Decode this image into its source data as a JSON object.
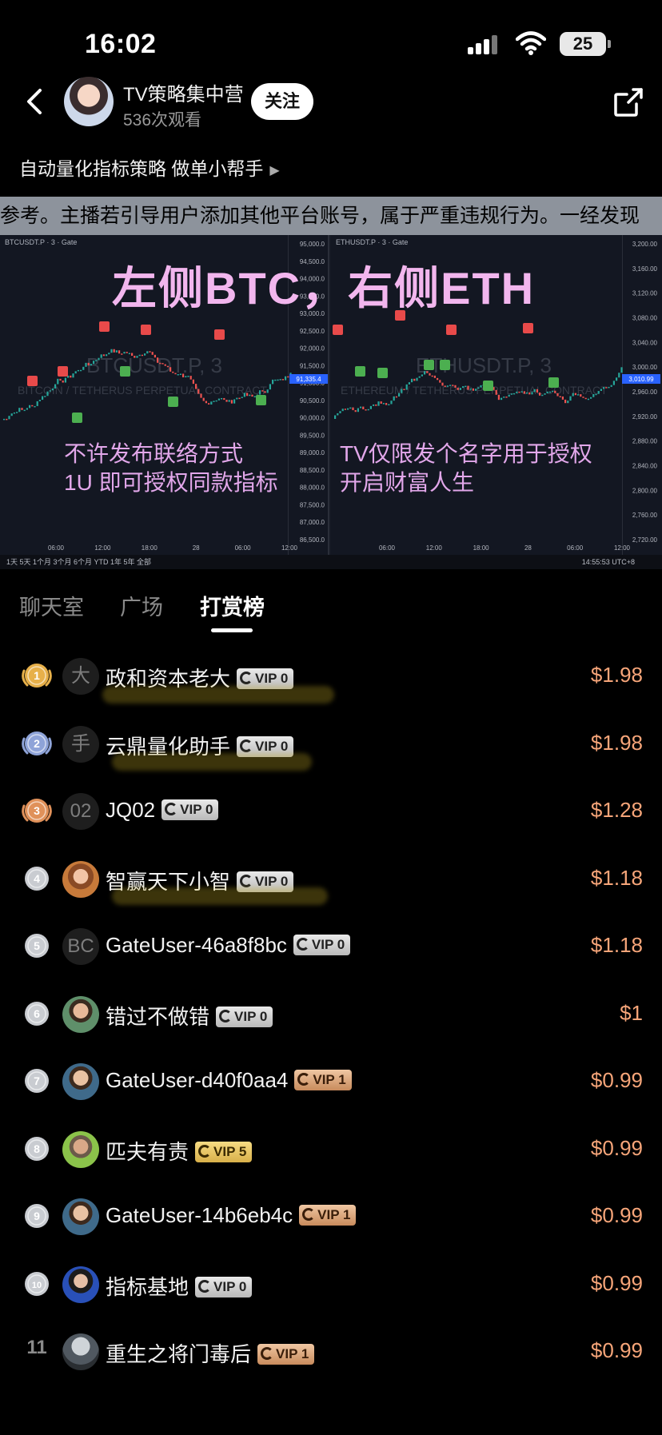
{
  "status_bar": {
    "time": "16:02",
    "battery": "25"
  },
  "header": {
    "host_name": "TV策略集中营",
    "views": "536次观看",
    "follow_label": "关注",
    "subtitle": "自动量化指标策略 做单小帮手",
    "subtitle_arrow": "▶"
  },
  "video": {
    "marquee": "参考。主播若引导用户添加其他平台账号，属于严重违规行为。一经发现",
    "title": "左侧BTC，右侧ETH",
    "left_line1": "不许发布联络方式",
    "left_line2": "1U 即可授权同款指标",
    "right_line1": "TV仅限发个名字用于授权",
    "right_line2": "开启财富人生",
    "btc_ticker": "BTCUSDT.P · 3 · Gate",
    "eth_ticker": "ETHUSDT.P · 3 · Gate",
    "btc_watermark": "BTCUSDT.P, 3",
    "btc_watermark2": "BITCOIN / TETHERUS PERPETUAL CONTRACT",
    "eth_watermark": "ETHUSDT.P, 3",
    "eth_watermark2": "ETHEREUM / TETHERUS PERPETUAL CONTRACT",
    "btc_price_label": "91,335.4",
    "eth_price_label": "3,010.99",
    "btc_axis": [
      "95,000.0",
      "94,500.0",
      "94,000.0",
      "93,500.0",
      "93,000.0",
      "92,500.0",
      "92,000.0",
      "91,500.0",
      "91,000.0",
      "90,500.0",
      "90,000.0",
      "89,500.0",
      "89,000.0",
      "88,500.0",
      "88,000.0",
      "87,500.0",
      "87,000.0",
      "86,500.0"
    ],
    "eth_axis": [
      "3,200.00",
      "3,160.00",
      "3,120.00",
      "3,080.00",
      "3,040.00",
      "3,000.00",
      "2,960.00",
      "2,920.00",
      "2,880.00",
      "2,840.00",
      "2,800.00",
      "2,760.00",
      "2,720.00"
    ],
    "time_axis_left": [
      "06:00",
      "12:00",
      "18:00",
      "28",
      "06:00",
      "12:00"
    ],
    "time_axis_right": [
      "06:00",
      "12:00",
      "18:00",
      "28",
      "06:00",
      "12:00"
    ],
    "bottom_toolbar": "1天  5天  1个月  3个月  6个月  YTD  1年  5年  全部",
    "bottom_time": "14:55:53 UTC+8"
  },
  "tabs": [
    {
      "label": "聊天室"
    },
    {
      "label": "广场"
    },
    {
      "label": "打赏榜"
    }
  ],
  "leaderboard": [
    {
      "rank": "1",
      "avatar": "大",
      "name": "政和资本老大",
      "vip": "VIP 0",
      "amount": "$1.98"
    },
    {
      "rank": "2",
      "avatar": "手",
      "name": "云鼎量化助手",
      "vip": "VIP 0",
      "amount": "$1.98"
    },
    {
      "rank": "3",
      "avatar": "02",
      "name": "JQ02",
      "vip": "VIP 0",
      "amount": "$1.28"
    },
    {
      "rank": "4",
      "avatar": "",
      "name": "智赢天下小智",
      "vip": "VIP 0",
      "amount": "$1.18"
    },
    {
      "rank": "5",
      "avatar": "BC",
      "name": "GateUser-46a8f8bc",
      "vip": "VIP 0",
      "amount": "$1.18"
    },
    {
      "rank": "6",
      "avatar": "",
      "name": "错过不做错",
      "vip": "VIP 0",
      "amount": "$1"
    },
    {
      "rank": "7",
      "avatar": "",
      "name": "GateUser-d40f0aa4",
      "vip": "VIP 1",
      "amount": "$0.99"
    },
    {
      "rank": "8",
      "avatar": "",
      "name": "匹夫有责",
      "vip": "VIP 5",
      "amount": "$0.99"
    },
    {
      "rank": "9",
      "avatar": "",
      "name": "GateUser-14b6eb4c",
      "vip": "VIP 1",
      "amount": "$0.99"
    },
    {
      "rank": "10",
      "avatar": "",
      "name": "指标基地",
      "vip": "VIP 0",
      "amount": "$0.99"
    },
    {
      "rank": "11",
      "avatar": "",
      "name": "重生之将门毒后",
      "vip": "VIP 1",
      "amount": "$0.99"
    }
  ],
  "colors": {
    "amount": "#f6a579",
    "title_pink": "#f2b6ee",
    "gold": "#e7b04a",
    "silver": "#8ea3d8",
    "bronze": "#e0915a"
  }
}
